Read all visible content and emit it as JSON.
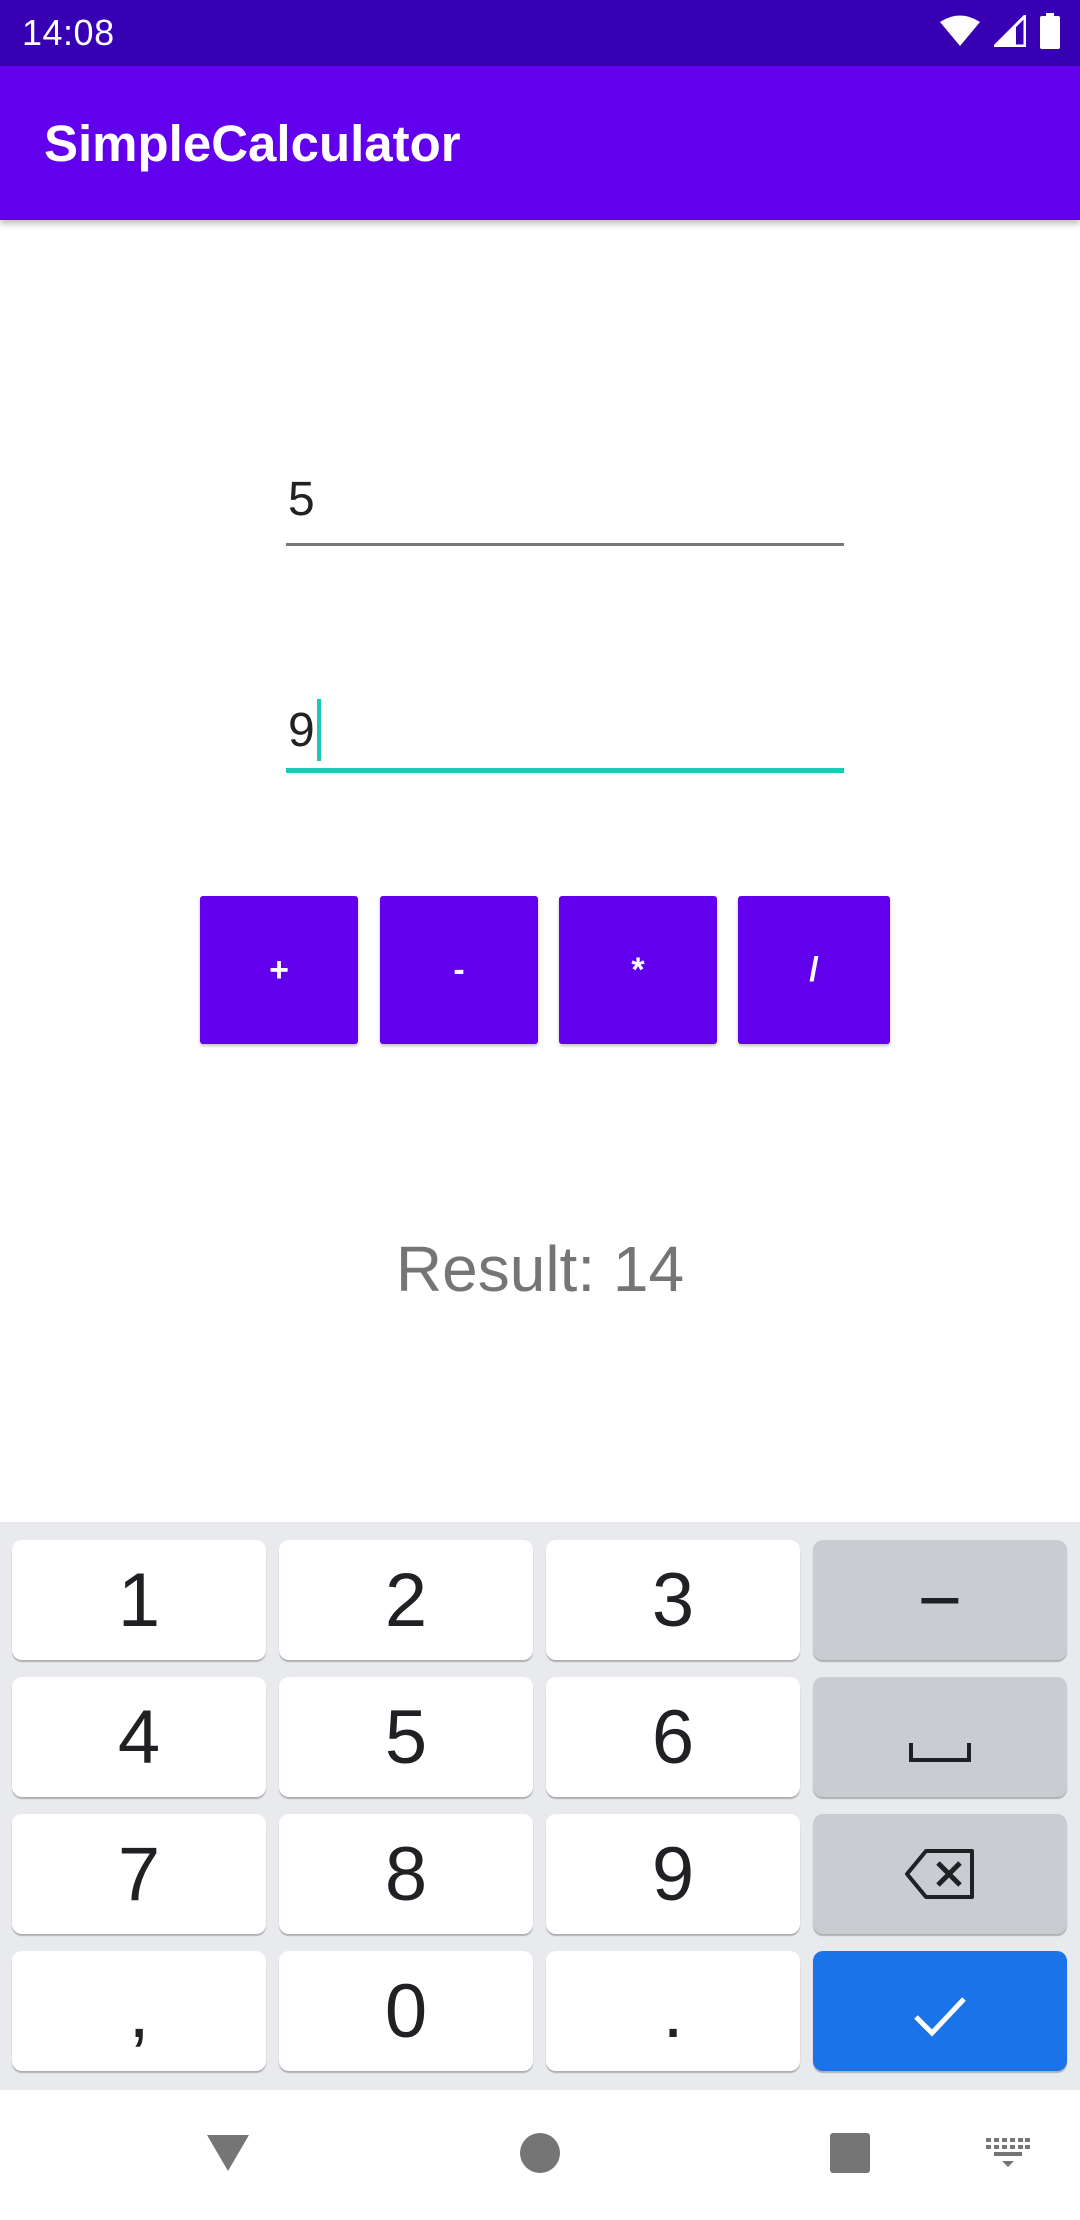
{
  "status_bar": {
    "time": "14:08",
    "icons": [
      "wifi-icon",
      "cell-signal-icon",
      "battery-icon"
    ]
  },
  "app_bar": {
    "title": "SimpleCalculator"
  },
  "inputs": {
    "first_value": "5",
    "second_value": "9"
  },
  "operations": [
    "+",
    "-",
    "*",
    "/"
  ],
  "result": {
    "text": "Result: 14"
  },
  "keyboard": {
    "rows": [
      [
        "1",
        "2",
        "3",
        "−"
      ],
      [
        "4",
        "5",
        "6",
        "space"
      ],
      [
        "7",
        "8",
        "9",
        "backspace"
      ],
      [
        ",",
        "0",
        ".",
        "enter"
      ]
    ],
    "labels": {
      "minus": "−"
    }
  },
  "nav_bar": {
    "icons": [
      "back-icon",
      "home-icon",
      "recents-icon",
      "keyboard-switch-icon"
    ]
  },
  "colors": {
    "status_bar": "#3700b3",
    "primary": "#6200ee",
    "accent": "#1ec8b4",
    "enter_key": "#1a73e8"
  }
}
